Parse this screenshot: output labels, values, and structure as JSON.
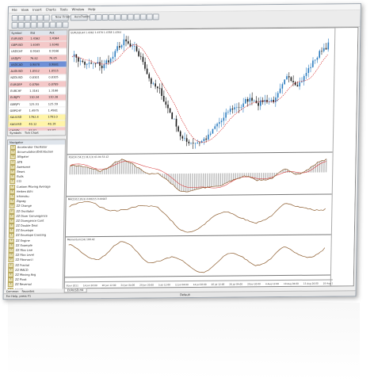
{
  "menu": [
    "File",
    "View",
    "Insert",
    "Charts",
    "Tools",
    "Window",
    "Help"
  ],
  "toolbar": {
    "new_order": "New Order",
    "expert": "AutoTrading"
  },
  "market_watch": {
    "title": "Symbol",
    "columns": [
      "Symbol",
      "Bid",
      "Ask"
    ],
    "rows": [
      {
        "symbol": "EURUSD",
        "bid": "1.4362",
        "ask": "1.4364",
        "color": "#f4c8c8"
      },
      {
        "symbol": "GBPUSD",
        "bid": "1.6345",
        "ask": "1.6348",
        "color": "#f4c8c8"
      },
      {
        "symbol": "USDCHF",
        "bid": "0.9163",
        "ask": "0.9166",
        "color": "#ffffff"
      },
      {
        "symbol": "USDJPY",
        "bid": "76.82",
        "ask": "76.85",
        "color": "#f4c8c8"
      },
      {
        "symbol": "USDCAD",
        "bid": "0.9878",
        "ask": "0.9881",
        "color": "#6d8fd6"
      },
      {
        "symbol": "AUDUSD",
        "bid": "1.0512",
        "ask": "1.0515",
        "color": "#f4c8c8"
      },
      {
        "symbol": "NZDUSD",
        "bid": "0.8301",
        "ask": "0.8305",
        "color": "#ffffff"
      },
      {
        "symbol": "EURGBP",
        "bid": "0.8786",
        "ask": "0.8789",
        "color": "#f4c8c8"
      },
      {
        "symbol": "EURCHF",
        "bid": "1.3161",
        "ask": "1.3166",
        "color": "#ffffff"
      },
      {
        "symbol": "EURJPY",
        "bid": "110.34",
        "ask": "110.38",
        "color": "#f4c8c8"
      },
      {
        "symbol": "GBPJPY",
        "bid": "125.53",
        "ask": "125.59",
        "color": "#ffffff"
      },
      {
        "symbol": "GBPCHF",
        "bid": "1.4975",
        "ask": "1.4981",
        "color": "#ffffff"
      },
      {
        "symbol": "XAUUSD",
        "bid": "1762.4",
        "ask": "1763.0",
        "color": "#fff4a8"
      },
      {
        "symbol": "XAGUSD",
        "bid": "40.12",
        "ask": "40.19",
        "color": "#fff4a8"
      },
      {
        "symbol": "CHFJPY",
        "bid": "83.82",
        "ask": "83.87",
        "color": "#f4c8c8"
      }
    ],
    "tabs": [
      "Symbols",
      "Tick Chart"
    ]
  },
  "navigator": {
    "title": "Navigator",
    "items": [
      "Accelerator Oscillator",
      "Accumulation/Distribution",
      "Alligator",
      "ATR",
      "Awesome",
      "Bears",
      "Bulls",
      "CCI",
      "Custom Moving Average",
      "Heiken Ashi",
      "Ichimoku",
      "Zigzag",
      "ZZ Change",
      "ZZ Oscillator",
      "ZZ Diver Convergence",
      "ZZ Divergence Cont",
      "ZZ Double Deal",
      "ZZ Envelope",
      "ZZ Envelope Crossing",
      "ZZ Engine",
      "ZZ Example",
      "ZZ Fibo Line",
      "ZZ Fibo Level",
      "ZZ Fibonacci",
      "ZZ Fractal",
      "ZZ MACD",
      "ZZ Moving Avg",
      "ZZ Pivot",
      "ZZ Reversal",
      "MACD"
    ],
    "tabs": [
      "Common",
      "Favorites"
    ]
  },
  "chart": {
    "header": "EURUSD,H4 1.4362 1.4370 1.4358 1.4364",
    "pane2_label": "RSI(14) 54.21 (8,3,3) 61.04 53.12",
    "pane3_label": "MACD(12,26,9) 0.00215 0.00187",
    "pane4_label": "Momentum(14) 100.42",
    "time_labels": [
      "8 Jun 2011",
      "14 Jun 20:00",
      "20 Jun 12:00",
      "24 Jun 04:00",
      "29 Jun 20:00",
      "5 Jul 12:00",
      "11 Jul 04:00",
      "14 Jul 20:00",
      "20 Jul 12:00",
      "26 Jul 04:00",
      "29 Jul 20:00",
      "4 Aug 12:00",
      "10 Aug 04:00",
      "15 Aug 20:00",
      "19 Aug 12:00",
      "25 Aug 04:00",
      "30 Aug 20:00"
    ],
    "tabs": [
      "EURUSD,H4"
    ],
    "colors": {
      "bull": "#2a7bbf",
      "bear": "#1a1a1a",
      "ma": "#d22020",
      "ind": "#8b5a2b"
    }
  },
  "status": {
    "help": "For Help, press F1",
    "profile": "Default"
  }
}
